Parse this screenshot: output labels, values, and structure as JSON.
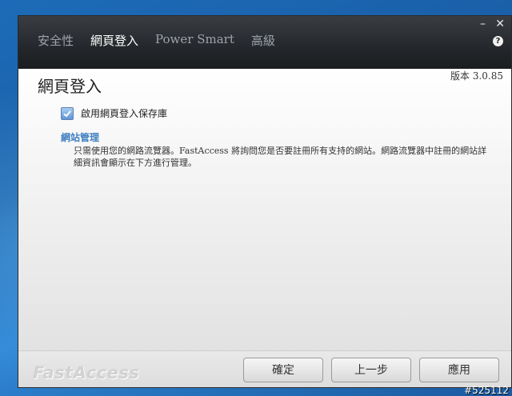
{
  "nav": {
    "tabs": [
      {
        "label": "安全性"
      },
      {
        "label": "網頁登入"
      },
      {
        "label": "Power Smart"
      },
      {
        "label": "高級"
      }
    ],
    "active_index": 1
  },
  "window_controls": {
    "minimize": "–",
    "close": "✕",
    "help": "?"
  },
  "header": {
    "version": "版本 3.0.85",
    "title": "網頁登入"
  },
  "options": {
    "enable_checkbox": {
      "label": "啟用網頁登入保存庫",
      "checked": true
    }
  },
  "section": {
    "title": "網站管理",
    "description": "只需使用您的網路流覽器。FastAccess 將詢問您是否要註冊所有支持的網站。網路流覽器中註冊的網站詳細資訊會顯示在下方進行管理。"
  },
  "footer": {
    "logo": "FastAccess",
    "buttons": {
      "ok": "確定",
      "back": "上一步",
      "apply": "應用"
    }
  },
  "watermark": "#525112",
  "colors": {
    "accent": "#3f7fc0",
    "titlebar": "#24272b"
  }
}
